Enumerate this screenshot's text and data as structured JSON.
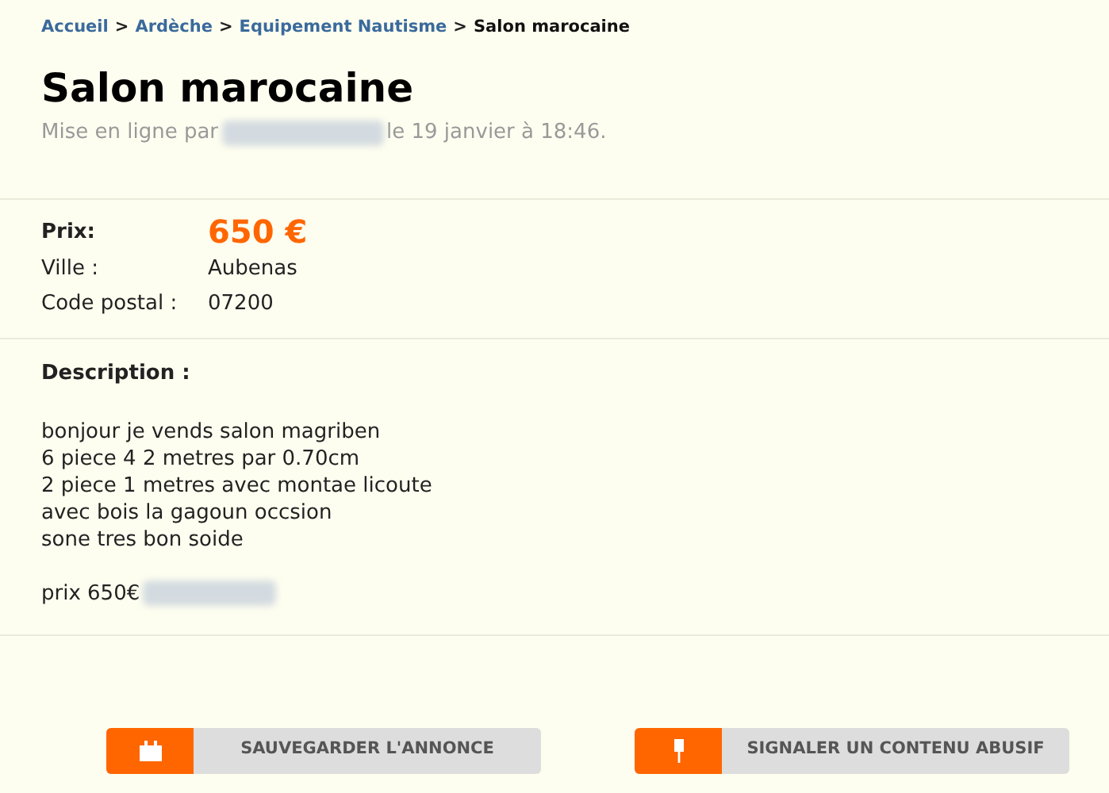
{
  "breadcrumb": [
    {
      "label": "Accueil",
      "kind": "link"
    },
    {
      "label": "Ardèche",
      "kind": "link"
    },
    {
      "label": "Equipement Nautisme",
      "kind": "link"
    },
    {
      "label": "Salon marocaine",
      "kind": "current"
    }
  ],
  "breadcrumb_separator": ">",
  "title": "Salon marocaine",
  "posted": {
    "before": "Mise en ligne par",
    "after": "le 19 janvier à 18:46."
  },
  "price": {
    "label": "Prix:",
    "value": "650 €"
  },
  "details": [
    {
      "label": "Ville :",
      "value": "Aubenas"
    },
    {
      "label": "Code postal :",
      "value": "07200"
    }
  ],
  "description": {
    "label": "Description :",
    "lines": [
      "bonjour je vends salon magriben",
      "6 piece 4 2 metres par 0.70cm",
      "2 piece 1 metres avec montae licoute",
      "avec bois la gagoun occsion",
      "sone tres bon soide"
    ],
    "last_line": "prix 650€"
  },
  "buttons": [
    {
      "label": "SAUVEGARDER L'ANNONCE",
      "kind": "save"
    },
    {
      "label": "SIGNALER UN CONTENU ABUSIF",
      "kind": "report"
    }
  ]
}
